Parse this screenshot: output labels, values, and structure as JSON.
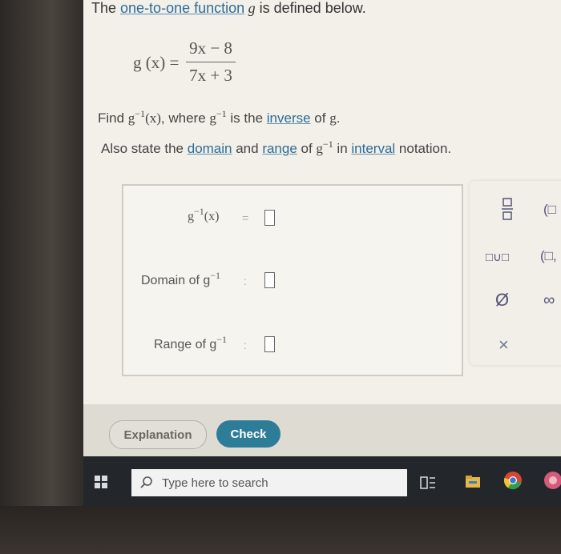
{
  "problem": {
    "intro_prefix": "The ",
    "intro_link": "one-to-one function",
    "intro_var": " g",
    "intro_suffix": " is defined below.",
    "func_lhs": "g (x) =",
    "func_numerator": "9x − 8",
    "func_denominator": "7x + 3",
    "find_prefix": "Find ",
    "find_g": "g",
    "inv_sup": "−1",
    "find_x": "(x)",
    "find_where": ", where ",
    "find_g2": "g",
    "inv_sup2": "−1",
    "find_is_the": " is the ",
    "find_link": "inverse",
    "find_of": " of ",
    "find_g3": "g",
    "find_end": ".",
    "also_prefix": "Also state the ",
    "domain_link": "domain",
    "and_text": " and ",
    "range_link": "range",
    "of_text": " of ",
    "also_g": "g",
    "inv_sup3": "−1",
    "in_text": " in ",
    "interval_link": "interval",
    "notation_text": " notation."
  },
  "answers": {
    "inverse_label": "g",
    "inverse_sup": "−1",
    "inverse_x": "(x)",
    "inverse_eq": "=",
    "domain_label": "Domain of g",
    "domain_sup": "−1",
    "domain_sep": ":",
    "range_label": "Range of g",
    "range_sup": "−1",
    "range_sep": ":"
  },
  "palette": {
    "fraction_icon": "fraction-icon",
    "open_interval": "(□",
    "union": "□∪□",
    "interval_pair": "(□,",
    "empty_set": "Ø",
    "infinity": "∞",
    "clear": "×"
  },
  "buttons": {
    "explanation": "Explanation",
    "check": "Check"
  },
  "taskbar": {
    "search_placeholder": "Type here to search"
  },
  "colors": {
    "link": "#2d6c95",
    "check_button": "#2e7d98",
    "taskbar": "#23262a"
  }
}
